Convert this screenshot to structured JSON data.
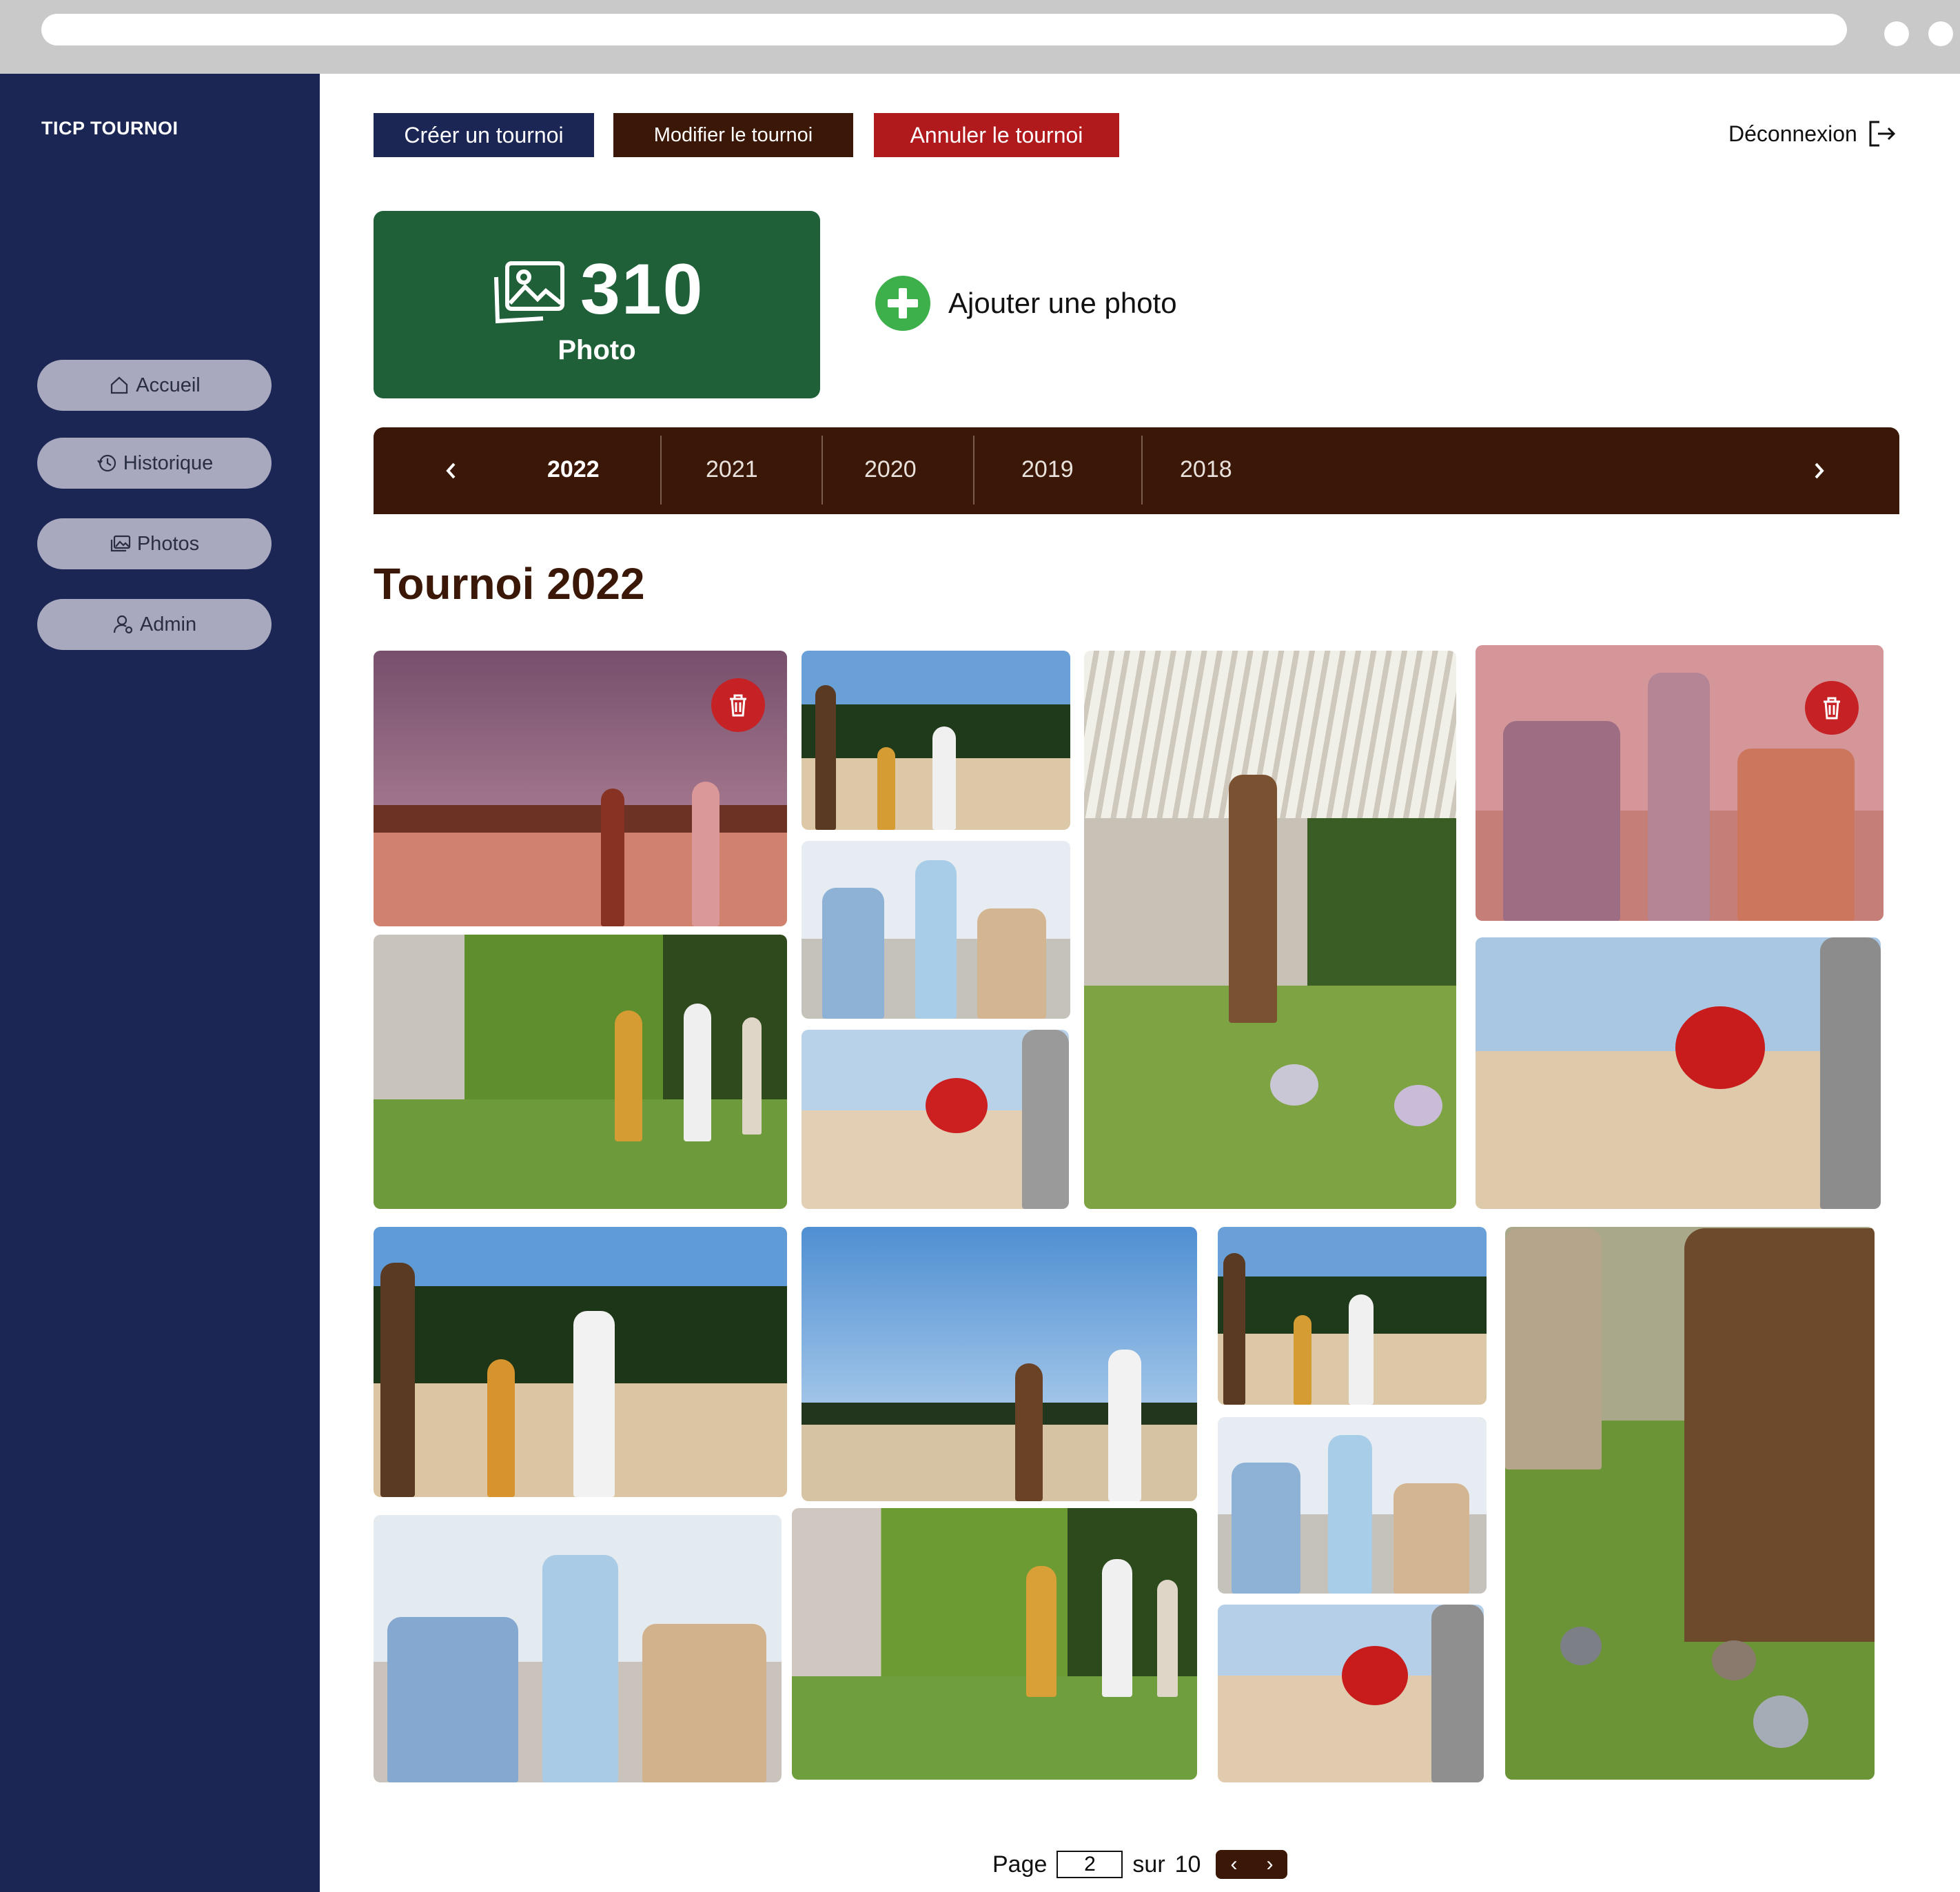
{
  "app": {
    "brand": "TICP TOURNOI"
  },
  "sidebar": {
    "items": [
      {
        "label": "Accueil",
        "icon": "home-icon"
      },
      {
        "label": "Historique",
        "icon": "history-icon"
      },
      {
        "label": "Photos",
        "icon": "photos-icon"
      },
      {
        "label": "Admin",
        "icon": "admin-icon"
      }
    ]
  },
  "toolbar": {
    "create_label": "Créer un tournoi",
    "edit_label": "Modifier le tournoi",
    "cancel_label": "Annuler le tournoi",
    "logout_label": "Déconnexion"
  },
  "stats": {
    "photo_count": "310",
    "photo_label": "Photo"
  },
  "add_photo_label": "Ajouter une photo",
  "years": {
    "selected": "2022",
    "items": [
      "2022",
      "2021",
      "2020",
      "2019",
      "2018"
    ]
  },
  "section_title": "Tournoi 2022",
  "pagination": {
    "page_label": "Page",
    "current": "2",
    "of_label": "sur",
    "total": "10"
  },
  "colors": {
    "sidebar": "#1b2654",
    "create_button": "#1b2654",
    "edit_button": "#3a1706",
    "cancel_button": "#b11a1d",
    "stat_card": "#1f6039",
    "year_bar": "#3a1706",
    "add_icon": "#3daf4b",
    "delete_badge": "#c62226"
  }
}
